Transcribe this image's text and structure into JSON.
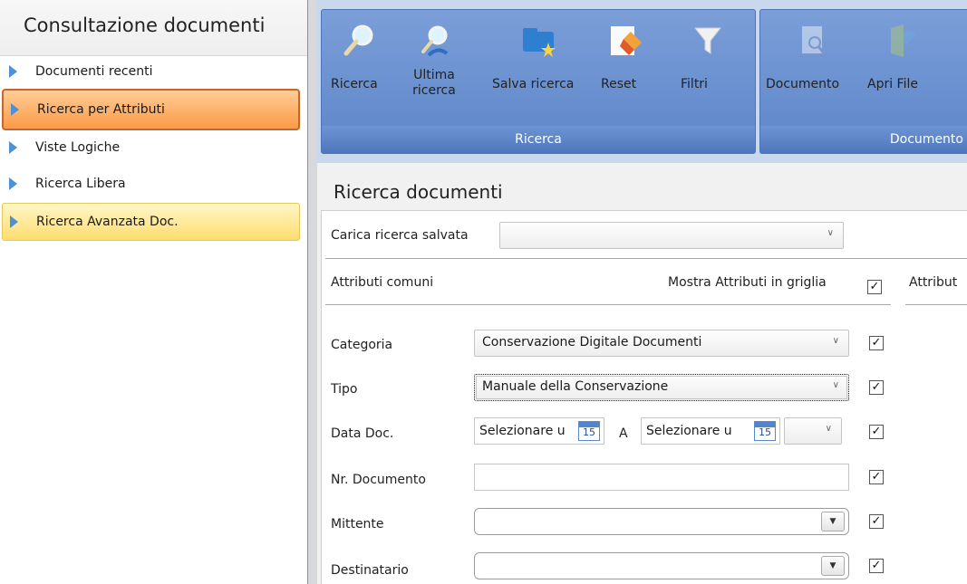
{
  "left_panel": {
    "title": "Consultazione documenti",
    "items": [
      {
        "label": "Documenti recenti",
        "state": "normal"
      },
      {
        "label": "Ricerca per Attributi",
        "state": "selected"
      },
      {
        "label": "Viste Logiche",
        "state": "normal"
      },
      {
        "label": "Ricerca Libera",
        "state": "normal"
      },
      {
        "label": "Ricerca Avanzata Doc.",
        "state": "hover"
      }
    ]
  },
  "ribbon": {
    "groups": [
      {
        "label": "Ricerca",
        "buttons": [
          {
            "label": "Ricerca",
            "icon": "magnifier-icon",
            "enabled": true
          },
          {
            "label": "Ultima ricerca",
            "icon": "last-search-icon",
            "enabled": true
          },
          {
            "label": "Salva ricerca",
            "icon": "save-search-folder-icon",
            "enabled": true
          },
          {
            "label": "Reset",
            "icon": "eraser-icon",
            "enabled": true
          },
          {
            "label": "Filtri",
            "icon": "funnel-icon",
            "enabled": true
          }
        ]
      },
      {
        "label": "Documento",
        "buttons": [
          {
            "label": "Documento",
            "icon": "document-preview-icon",
            "enabled": false
          },
          {
            "label": "Apri File",
            "icon": "open-file-icon",
            "enabled": false
          }
        ]
      }
    ]
  },
  "main": {
    "title": "Ricerca documenti",
    "saved_search_label": "Carica ricerca salvata",
    "saved_search_value": "",
    "common_attributes_label": "Attributi comuni",
    "show_in_grid_label": "Mostra Attributi in griglia",
    "show_in_grid_checked": true,
    "other_section_label": "Attribut",
    "fields": {
      "categoria": {
        "label": "Categoria",
        "value": "Conservazione Digitale Documenti",
        "checked": true
      },
      "tipo": {
        "label": "Tipo",
        "value": "Manuale della Conservazione",
        "checked": true
      },
      "data_doc": {
        "label": "Data Doc.",
        "from_placeholder": "Selezionare u",
        "to_label": "A",
        "to_placeholder": "Selezionare u",
        "calendar_day": "15",
        "checked": true
      },
      "nr_documento": {
        "label": "Nr. Documento",
        "value": "",
        "checked": true
      },
      "mittente": {
        "label": "Mittente",
        "value": "",
        "checked": true
      },
      "destinatario": {
        "label": "Destinatario",
        "value": "",
        "checked": true
      }
    }
  },
  "colors": {
    "ribbon_blue": "#5d86c9",
    "selected_orange": "#fb9a47",
    "hover_yellow": "#ffdc6e",
    "nav_arrow_blue": "#4f8fd6"
  }
}
